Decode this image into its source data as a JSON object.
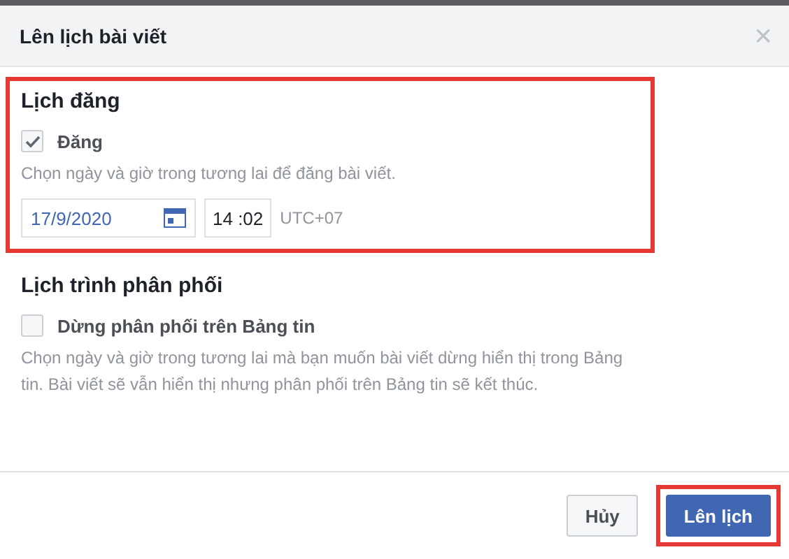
{
  "dialog": {
    "title": "Lên lịch bài viết",
    "close": "×"
  },
  "sections": [
    {
      "heading": "Lịch đăng",
      "highlighted": true,
      "option": {
        "label": "Đăng",
        "checked": true
      },
      "description": "Chọn ngày và giờ trong tương lai để đăng bài viết.",
      "date": "17/9/2020",
      "time": "14 :02",
      "timezone": "UTC+07"
    },
    {
      "heading": "Lịch trình phân phối",
      "highlighted": false,
      "option": {
        "label": "Dừng phân phối trên Bảng tin",
        "checked": false
      },
      "description": "Chọn ngày và giờ trong tương lai mà bạn muốn bài viết dừng hiển thị trong Bảng tin. Bài viết sẽ vẫn hiển thị nhưng phân phối trên Bảng tin sẽ kết thúc."
    }
  ],
  "buttons": [
    {
      "label": "Hủy",
      "kind": "secondary",
      "highlighted": false
    },
    {
      "label": "Lên lịch",
      "kind": "primary",
      "highlighted": true
    }
  ]
}
